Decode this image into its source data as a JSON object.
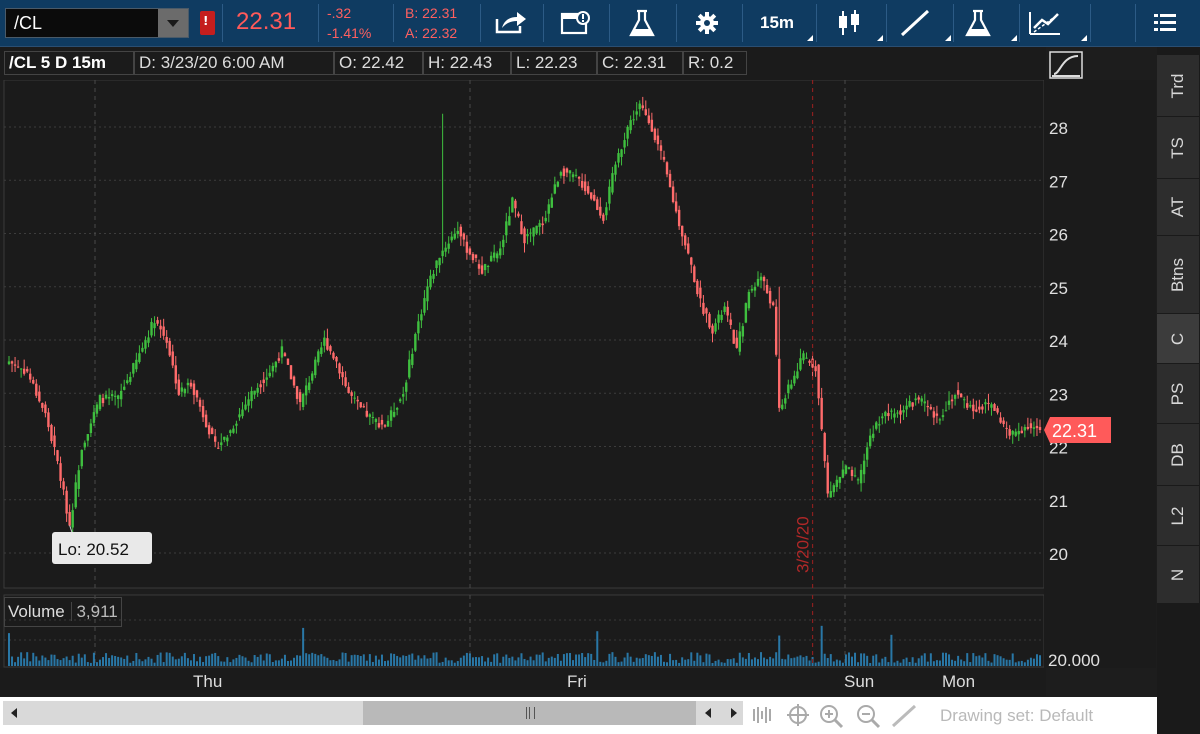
{
  "header": {
    "symbol": "/CL",
    "alert_badge": "!",
    "last_price": "22.31",
    "net_change": "-.32",
    "pct_change": "-1.41%",
    "bid": "B: 22.31",
    "ask": "A: 22.32",
    "timeframe": "15m",
    "icons": [
      "share-icon",
      "message-icon",
      "flask-icon",
      "gear-icon",
      "candlestick-icon",
      "drawing-line-icon",
      "study-flask-icon",
      "pattern-icon",
      "menu-icon"
    ]
  },
  "info_bar": {
    "title": "/CL 5 D 15m",
    "date": "D: 3/23/20 6:00 AM",
    "open": "O: 22.42",
    "high": "H: 22.43",
    "low": "L: 22.23",
    "close": "C: 22.31",
    "range": "R: 0.2"
  },
  "colors": {
    "up": "#3fbf3f",
    "down": "#ff6b6b",
    "price_bubble": "#ff5a5a",
    "expiry_line": "#8a1f1f",
    "volume": "#2d8fc9"
  },
  "chart_data": {
    "type": "candlestick",
    "y_ticks": [
      "28",
      "27",
      "26",
      "25",
      "24",
      "23",
      "22",
      "21",
      "20"
    ],
    "ylim": [
      19.3,
      29.2
    ],
    "x_ticks": [
      "Thu",
      "Fri",
      "Sun",
      "Mon"
    ],
    "current_price_label": "22.31",
    "low_annotation": "Lo: 20.52",
    "expiry_label": "3/20/20",
    "path": [
      [
        0,
        23.6
      ],
      [
        6,
        23.4
      ],
      [
        12,
        22.6
      ],
      [
        16,
        21.7
      ],
      [
        20,
        20.52
      ],
      [
        24,
        22.0
      ],
      [
        30,
        22.9
      ],
      [
        36,
        22.9
      ],
      [
        42,
        23.6
      ],
      [
        48,
        24.4
      ],
      [
        52,
        24.0
      ],
      [
        56,
        23.0
      ],
      [
        60,
        23.2
      ],
      [
        64,
        22.6
      ],
      [
        68,
        22.0
      ],
      [
        72,
        22.2
      ],
      [
        80,
        23.0
      ],
      [
        86,
        23.4
      ],
      [
        90,
        23.8
      ],
      [
        96,
        22.8
      ],
      [
        100,
        23.4
      ],
      [
        104,
        24.0
      ],
      [
        108,
        23.6
      ],
      [
        112,
        23.0
      ],
      [
        116,
        22.7
      ],
      [
        120,
        22.5
      ],
      [
        124,
        22.4
      ],
      [
        130,
        23.0
      ],
      [
        134,
        24.1
      ],
      [
        138,
        25.0
      ],
      [
        142,
        25.6
      ],
      [
        148,
        26.1
      ],
      [
        150,
        25.8
      ],
      [
        156,
        25.3
      ],
      [
        162,
        25.7
      ],
      [
        166,
        26.6
      ],
      [
        170,
        25.9
      ],
      [
        176,
        26.2
      ],
      [
        182,
        27.2
      ],
      [
        188,
        27.0
      ],
      [
        192,
        26.7
      ],
      [
        196,
        26.3
      ],
      [
        200,
        27.3
      ],
      [
        204,
        28.0
      ],
      [
        208,
        28.4
      ],
      [
        212,
        28.0
      ],
      [
        216,
        27.3
      ],
      [
        220,
        26.4
      ],
      [
        224,
        25.6
      ],
      [
        228,
        24.7
      ],
      [
        232,
        24.2
      ],
      [
        236,
        24.6
      ],
      [
        240,
        23.8
      ],
      [
        244,
        24.9
      ],
      [
        248,
        25.2
      ],
      [
        252,
        24.6
      ],
      [
        254,
        22.7
      ],
      [
        258,
        23.2
      ],
      [
        262,
        23.7
      ],
      [
        266,
        23.5
      ],
      [
        268,
        22.3
      ],
      [
        270,
        21.1
      ],
      [
        276,
        21.6
      ],
      [
        280,
        21.3
      ],
      [
        284,
        22.2
      ],
      [
        288,
        22.6
      ],
      [
        292,
        22.6
      ],
      [
        300,
        22.9
      ],
      [
        306,
        22.5
      ],
      [
        312,
        23.0
      ],
      [
        318,
        22.7
      ],
      [
        324,
        22.8
      ],
      [
        330,
        22.2
      ],
      [
        336,
        22.4
      ],
      [
        340,
        22.31
      ]
    ],
    "low_candle_index": 20
  },
  "volume_pane": {
    "label": "Volume",
    "value": "3,911",
    "axis_label": "20.000"
  },
  "side_tabs": [
    "Trd",
    "TS",
    "AT",
    "Btns",
    "C",
    "PS",
    "DB",
    "L2",
    "N"
  ],
  "side_active": "C",
  "scrollbar": {
    "drawing_set": "Drawing set: Default"
  }
}
